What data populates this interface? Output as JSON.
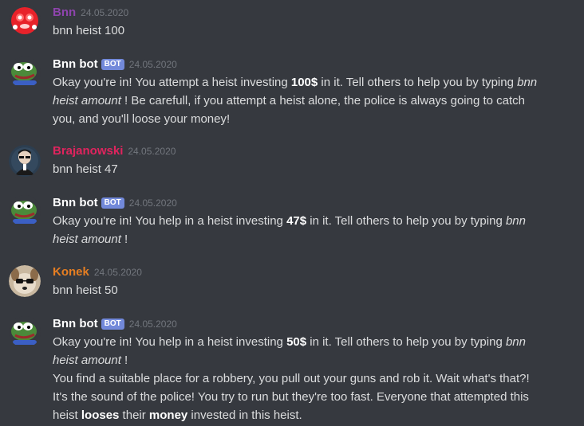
{
  "colors": {
    "background": "#36393f",
    "text": "#dcddde",
    "timestamp": "#72767d",
    "bot_tag": "#7289da",
    "bnn": "#8e44ad",
    "bnn_bot": "#ffffff",
    "brajanowski": "#e0245e",
    "konek": "#e67e22"
  },
  "messages": [
    {
      "author": "Bnn",
      "timestamp": "24.05.2020",
      "text": "bnn heist 100",
      "avatar_icon": "red-blob-avatar-icon"
    },
    {
      "author": "Bnn bot",
      "bot_tag": "BOT",
      "timestamp": "24.05.2020",
      "parts": {
        "a": "Okay you're in! You attempt a heist investing ",
        "b": "100$",
        "c": " in it. Tell others to help you by typing ",
        "d": "bnn heist amount",
        "e": " ! Be carefull, if you attempt a heist alone, the police is always going to catch you, and you'll loose your money!"
      },
      "avatar_icon": "pepe-frog-avatar-icon"
    },
    {
      "author": "Brajanowski",
      "timestamp": "24.05.2020",
      "text": "bnn heist 47",
      "avatar_icon": "person-avatar-icon"
    },
    {
      "author": "Bnn bot",
      "bot_tag": "BOT",
      "timestamp": "24.05.2020",
      "parts": {
        "a": "Okay you're in! You help in a heist investing ",
        "b": "47$",
        "c": " in it. Tell others to help you by typing ",
        "d": "bnn heist amount",
        "e": " !"
      },
      "avatar_icon": "pepe-frog-avatar-icon"
    },
    {
      "author": "Konek",
      "timestamp": "24.05.2020",
      "text": "bnn heist 50",
      "avatar_icon": "dog-sunglasses-avatar-icon"
    },
    {
      "author": "Bnn bot",
      "bot_tag": "BOT",
      "timestamp": "24.05.2020",
      "parts": {
        "a": "Okay you're in! You help in a heist investing ",
        "b": "50$",
        "c": " in it. Tell others to help you by typing ",
        "d": "bnn heist amount",
        "e": " !"
      },
      "followup": {
        "a": "You find a suitable place for a robbery, you pull out your guns and rob it. Wait what's that?! It's the sound of the police! You try to run but they're too fast. Everyone that attempted this heist ",
        "b": "looses",
        "c": " their ",
        "d": "money",
        "e": " invested in this heist."
      },
      "avatar_icon": "pepe-frog-avatar-icon"
    }
  ]
}
